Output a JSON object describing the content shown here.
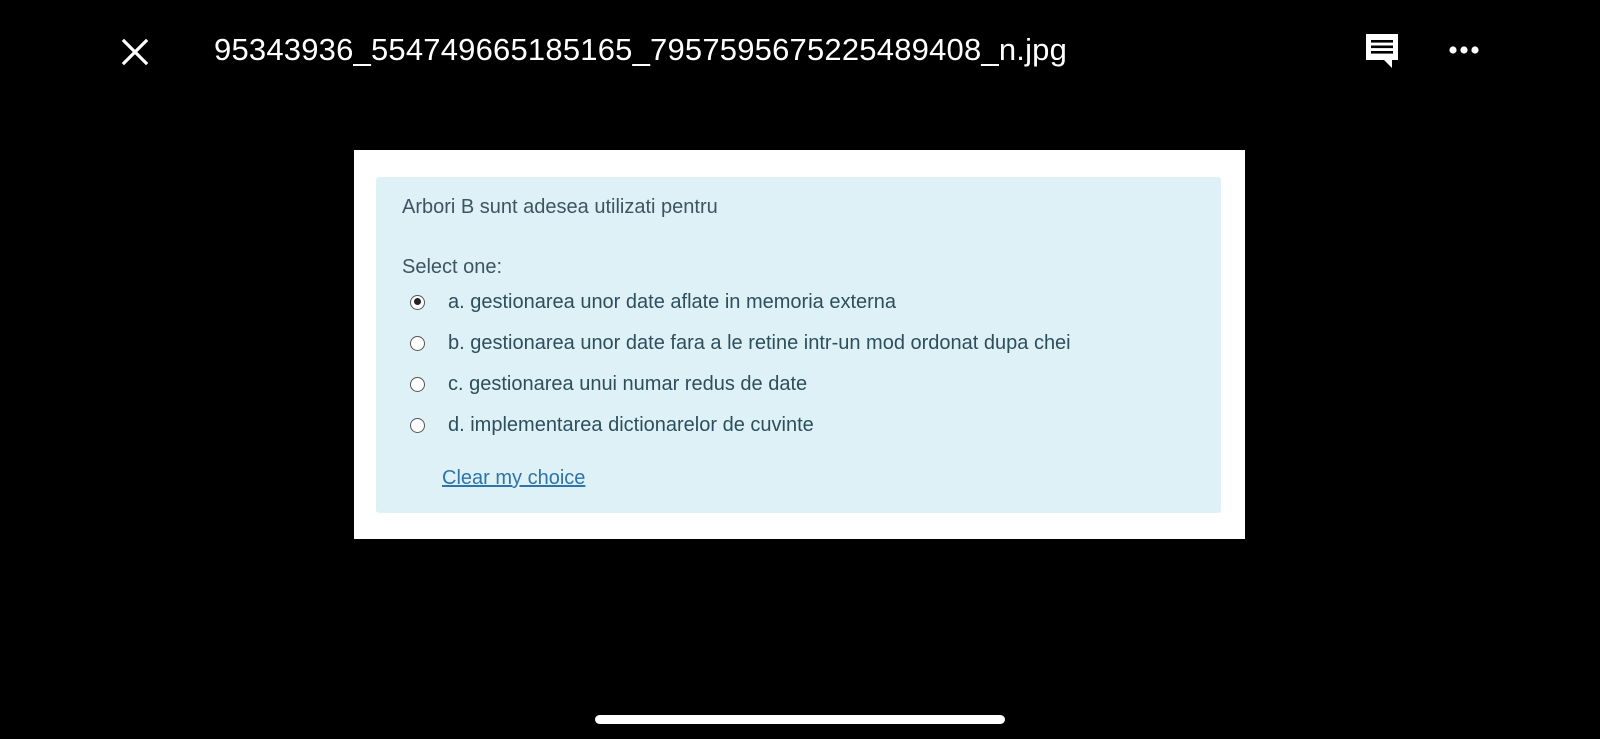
{
  "viewer": {
    "file_name": "95343936_554749665185165_7957595675225489408_n.jpg",
    "icons": {
      "close": "close-icon",
      "comment": "comment-icon",
      "more": "more-horizontal-icon"
    }
  },
  "quiz": {
    "question": "Arbori B sunt adesea utilizati pentru",
    "select_label": "Select one:",
    "options": [
      {
        "label": "a. gestionarea unor date aflate in memoria externa",
        "selected": true
      },
      {
        "label": "b. gestionarea unor date fara a le retine intr-un mod ordonat dupa chei",
        "selected": false
      },
      {
        "label": "c. gestionarea unui numar redus de date",
        "selected": false
      },
      {
        "label": "d. implementarea dictionarelor de cuvinte",
        "selected": false
      }
    ],
    "clear_label": "Clear my choice"
  },
  "colors": {
    "background": "#000000",
    "question_box": "#def1f7",
    "link": "#2f74a8"
  }
}
